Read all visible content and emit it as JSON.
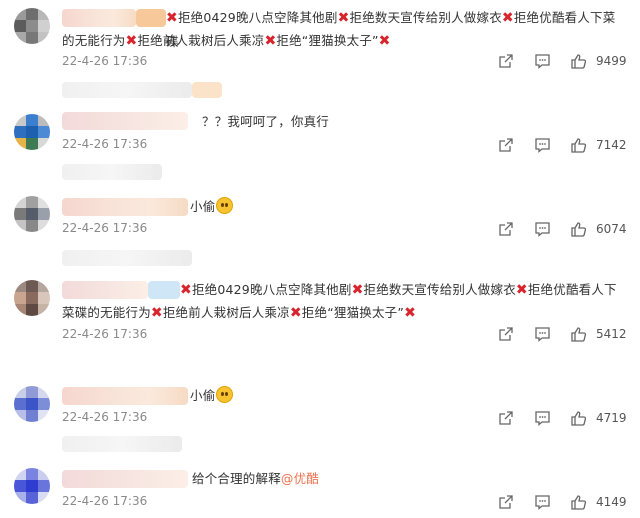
{
  "comments": [
    {
      "text_parts": [
        {
          "t": "x"
        },
        {
          "t": "s",
          "v": "拒绝0429晚八点空降其他剧"
        },
        {
          "t": "x"
        },
        {
          "t": "s",
          "v": "拒绝数天宣传给别人做嫁衣"
        },
        {
          "t": "x"
        },
        {
          "t": "s",
          "v": "拒绝优酷看人下菜碟"
        }
      ],
      "line2_parts": [
        {
          "t": "s",
          "v": "的无能行为"
        },
        {
          "t": "x"
        },
        {
          "t": "s",
          "v": "拒绝前人栽树后人乘凉"
        },
        {
          "t": "x"
        },
        {
          "t": "s",
          "v": "拒绝“狸猫换太子”"
        },
        {
          "t": "x"
        }
      ],
      "date": "22-4-26 17:36",
      "likes": "9499"
    },
    {
      "text": "？？我呵呵了，你真行",
      "date": "22-4-26 17:36",
      "likes": "7142"
    },
    {
      "text": "小偷",
      "date": "22-4-26 17:36",
      "likes": "6074"
    },
    {
      "text_parts": [
        {
          "t": "x"
        },
        {
          "t": "s",
          "v": "拒绝0429晚八点空降其他剧"
        },
        {
          "t": "x"
        },
        {
          "t": "s",
          "v": "拒绝数天宣传给别人做嫁衣"
        },
        {
          "t": "x"
        },
        {
          "t": "s",
          "v": "拒绝优酷看人下"
        }
      ],
      "line2_parts": [
        {
          "t": "s",
          "v": "菜碟的无能行为"
        },
        {
          "t": "x"
        },
        {
          "t": "s",
          "v": "拒绝前人栽树后人乘凉"
        },
        {
          "t": "x"
        },
        {
          "t": "s",
          "v": "拒绝“狸猫换太子”"
        },
        {
          "t": "x"
        }
      ],
      "date": "22-4-26 17:36",
      "likes": "5412"
    },
    {
      "text": "小偷",
      "date": "22-4-26 17:36",
      "likes": "4719"
    },
    {
      "text": "给个合理的解释",
      "mention": "@优酷",
      "date": "22-4-26 17:36",
      "likes": "4149"
    }
  ],
  "icons": {
    "share": "share-icon",
    "comment": "comment-icon",
    "like": "thumbs-up-icon",
    "close_mark": "red-cross-icon",
    "emoji": "smile-emoji-icon"
  },
  "colors": {
    "mark_red": "#d8242c",
    "mention": "#eb7350",
    "date_gray": "#8a8a8a"
  }
}
